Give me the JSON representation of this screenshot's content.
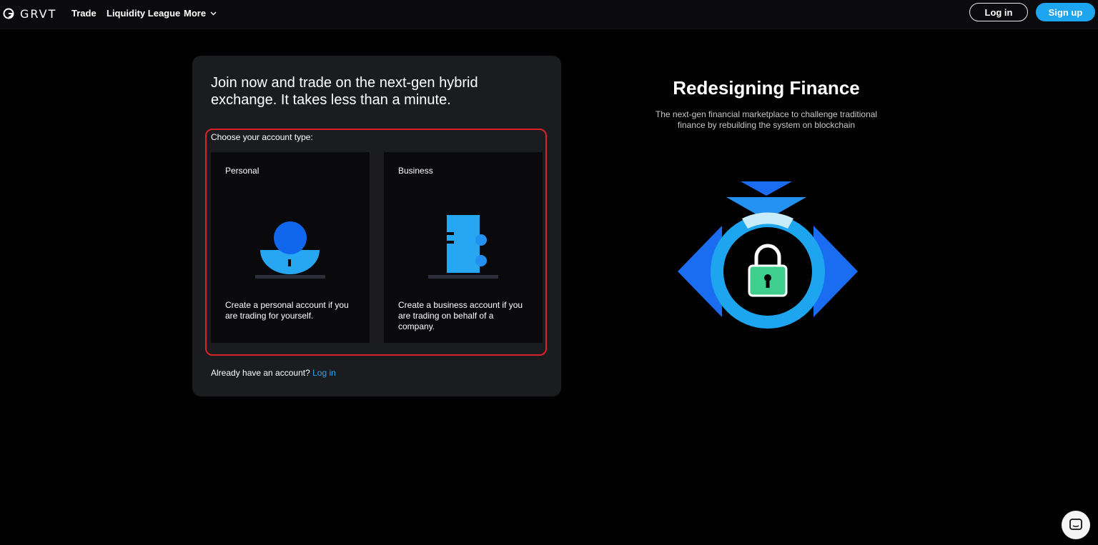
{
  "nav": {
    "brand": "GRVT",
    "links": [
      {
        "label": "Trade"
      },
      {
        "label": "Liquidity League"
      },
      {
        "label": "More"
      }
    ],
    "login_label": "Log in",
    "signup_label": "Sign up"
  },
  "signup": {
    "title": "Join now and trade on the next-gen hybrid exchange. It takes less than a minute.",
    "choose_label": "Choose your account type:",
    "options": [
      {
        "title": "Personal",
        "description": "Create a personal account if you are trading for yourself."
      },
      {
        "title": "Business",
        "description": "Create a business account if you are trading on behalf of a company."
      }
    ],
    "already_text": "Already have an account?",
    "login_link": "Log in"
  },
  "hero": {
    "title": "Redesigning Finance",
    "subtitle": "The next-gen financial marketplace to challenge traditional finance by rebuilding the system on blockchain"
  },
  "colors": {
    "accent": "#1ea5f0",
    "highlight_border": "#d9222a",
    "lock": "#3ecf8e"
  },
  "icons": {
    "chat": "chat-icon",
    "chevron": "chevron-down-icon",
    "logo": "grvt-logo-icon"
  }
}
